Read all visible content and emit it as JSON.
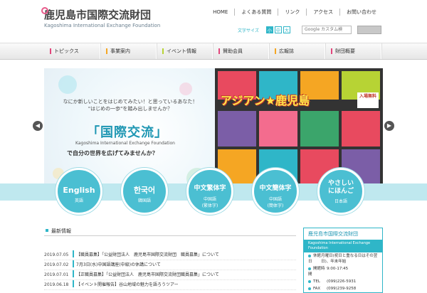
{
  "header": {
    "title": "鹿児島市国際交流財団",
    "subtitle": "Kagoshima International Exchange Foundation"
  },
  "topnav": [
    "HOME",
    "よくある質問",
    "リンク",
    "アクセス",
    "お問い合わせ"
  ],
  "fontsize": {
    "label": "文字サイズ",
    "small": "小",
    "medium": "中",
    "large": "大"
  },
  "search": {
    "placeholder": "Google カスタム検",
    "button": ""
  },
  "mainnav": [
    {
      "label": "トピックス",
      "color": "#e2467b"
    },
    {
      "label": "事業案内",
      "color": "#f5a623"
    },
    {
      "label": "イベント情報",
      "color": "#b7d334"
    },
    {
      "label": "賛助会員",
      "color": "#e2467b"
    },
    {
      "label": "広報誌",
      "color": "#f5a623"
    },
    {
      "label": "財団概要",
      "color": "#e2467b"
    }
  ],
  "hero": {
    "line1": "なにか新しいことをはじめてみたい！と思っているあなた！",
    "line2": "\"はじめの一歩\"を踏み出しませんか？",
    "big": "「国際交流」",
    "en": "Kagoshima International Exchange Foundation",
    "line3": "で自分の世界を広げてみませんか？",
    "poster_title": "アジアン★鹿児島",
    "poster_badge": "入場無料"
  },
  "languages": [
    {
      "main": "English",
      "sub": "英語"
    },
    {
      "main": "한국어",
      "sub": "韓国語"
    },
    {
      "main": "中文繁体字",
      "sub": "中国語\n(繁体字)"
    },
    {
      "main": "中文簡体字",
      "sub": "中国語\n(簡体字)"
    },
    {
      "main": "やさしい\nにほんご",
      "sub": "日本語"
    }
  ],
  "news": {
    "heading": "最新情報",
    "items": [
      {
        "date": "2019.07.05",
        "text": "【職員募集】「公益財団法人　鹿児島市国際交流財団　職員募集」について"
      },
      {
        "date": "2019.07.02",
        "text": "7月3日(水)中国語講座(中級)の休講について"
      },
      {
        "date": "2019.07.01",
        "text": "【正職員募集】「公益財団法人　鹿児島市国際交流財団職員募集」について"
      },
      {
        "date": "2019.06.18",
        "text": "【イベント開催報告】谷山地域の魅力を語ろうツアー"
      }
    ]
  },
  "side": {
    "title": "鹿児島市国際交流財団",
    "band": "Kagoshima International Exchange Foundation",
    "rows": [
      {
        "k": "休館日",
        "v": "月曜日(祝日と重なる日はその翌日)、年末年始"
      },
      {
        "k": "開館時間",
        "v": "9:00-17:45"
      },
      {
        "k": "TEL",
        "v": "(099)226-5931"
      },
      {
        "k": "FAX",
        "v": "(099)239-9258"
      }
    ]
  }
}
